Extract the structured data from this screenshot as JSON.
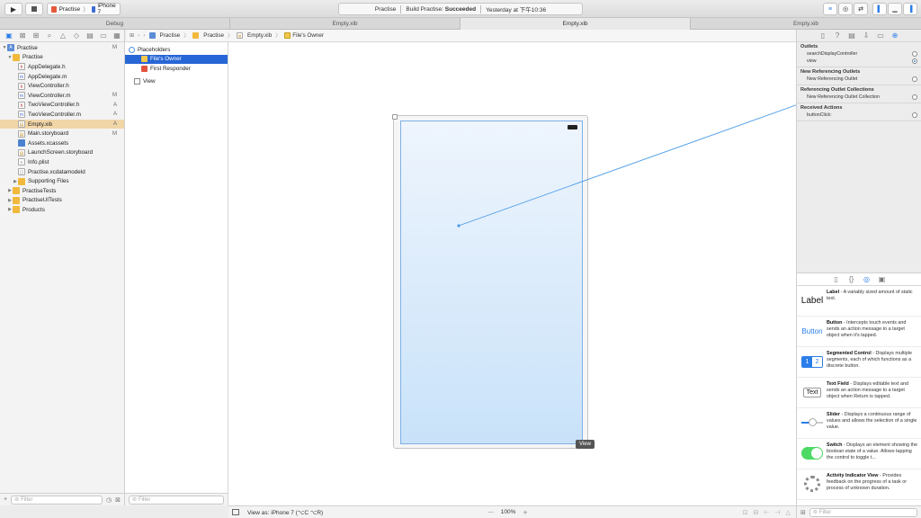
{
  "toolbar": {
    "scheme_project": "Practise",
    "scheme_device": "iPhone 7",
    "status_project": "Practise",
    "status_build_prefix": "Build Practise:",
    "status_build_result": "Succeeded",
    "status_time": "Yesterday at 下午10:36"
  },
  "tabs": [
    {
      "label": "Debug"
    },
    {
      "label": "Empty.xib"
    },
    {
      "label": "Empty.xib"
    },
    {
      "label": "Empty.xib"
    }
  ],
  "navigator": {
    "items": [
      {
        "label": "Practise",
        "badge": "M"
      },
      {
        "label": "Practise",
        "badge": ""
      },
      {
        "label": "AppDelegate.h",
        "badge": ""
      },
      {
        "label": "AppDelegate.m",
        "badge": ""
      },
      {
        "label": "ViewController.h",
        "badge": ""
      },
      {
        "label": "ViewController.m",
        "badge": "M"
      },
      {
        "label": "TwoViewController.h",
        "badge": "A"
      },
      {
        "label": "TwoViewController.m",
        "badge": "A"
      },
      {
        "label": "Empty.xib",
        "badge": "A"
      },
      {
        "label": "Main.storyboard",
        "badge": "M"
      },
      {
        "label": "Assets.xcassets",
        "badge": ""
      },
      {
        "label": "LaunchScreen.storyboard",
        "badge": ""
      },
      {
        "label": "Info.plist",
        "badge": ""
      },
      {
        "label": "Practise.xcdatamodeld",
        "badge": ""
      },
      {
        "label": "Supporting Files",
        "badge": ""
      },
      {
        "label": "PractiseTests",
        "badge": ""
      },
      {
        "label": "PractiseUITests",
        "badge": ""
      },
      {
        "label": "Products",
        "badge": ""
      }
    ],
    "filter_placeholder": "Filter"
  },
  "jumpbar": {
    "crumbs": [
      "Practise",
      "Practise",
      "Empty.xib",
      "File's Owner"
    ]
  },
  "outline": {
    "section": "Placeholders",
    "files_owner": "File's Owner",
    "first_responder": "First Responder",
    "view": "View",
    "filter_placeholder": "Filter"
  },
  "canvas": {
    "view_tag": "View",
    "view_as": "View as: iPhone 7 (⌥C ⌥R)",
    "zoom": "100%",
    "zoom_minus": "—",
    "zoom_plus": "+"
  },
  "inspector": {
    "outlets_title": "Outlets",
    "outlets": [
      "searchDisplayController",
      "view"
    ],
    "ref_outlets_title": "New Referencing Outlets",
    "ref_outlets": [
      "New Referencing Outlet"
    ],
    "ref_collections_title": "Referencing Outlet Collections",
    "ref_collections": [
      "New Referencing Outlet Collection"
    ],
    "received_title": "Received Actions",
    "received": [
      "buttonClick:"
    ]
  },
  "library": {
    "items": [
      {
        "thumb": "Label",
        "name": "Label",
        "desc": " - A variably sized amount of static text."
      },
      {
        "thumb": "Button",
        "name": "Button",
        "desc": " - Intercepts touch events and sends an action message to a target object when it's tapped."
      },
      {
        "thumb": "",
        "name": "Segmented Control",
        "desc": " - Displays multiple segments, each of which functions as a discrete button."
      },
      {
        "thumb": "Text",
        "name": "Text Field",
        "desc": " - Displays editable text and sends an action message to a target object when Return is tapped."
      },
      {
        "thumb": "",
        "name": "Slider",
        "desc": " - Displays a continuous range of values and allows the selection of a single value."
      },
      {
        "thumb": "",
        "name": "Switch",
        "desc": " - Displays an element showing the boolean state of a value. Allows tapping the control to toggle t..."
      },
      {
        "thumb": "",
        "name": "Activity Indicator View",
        "desc": " - Provides feedback on the progress of a task or process of unknown duration."
      }
    ],
    "segment_labels": [
      "1",
      "2"
    ],
    "filter_placeholder": "Filter"
  },
  "colors": {
    "accent": "#2b7de9",
    "selection_file": "#f1d6a8",
    "selection_outline": "#2766d6",
    "connection_line": "#4a9be8"
  }
}
